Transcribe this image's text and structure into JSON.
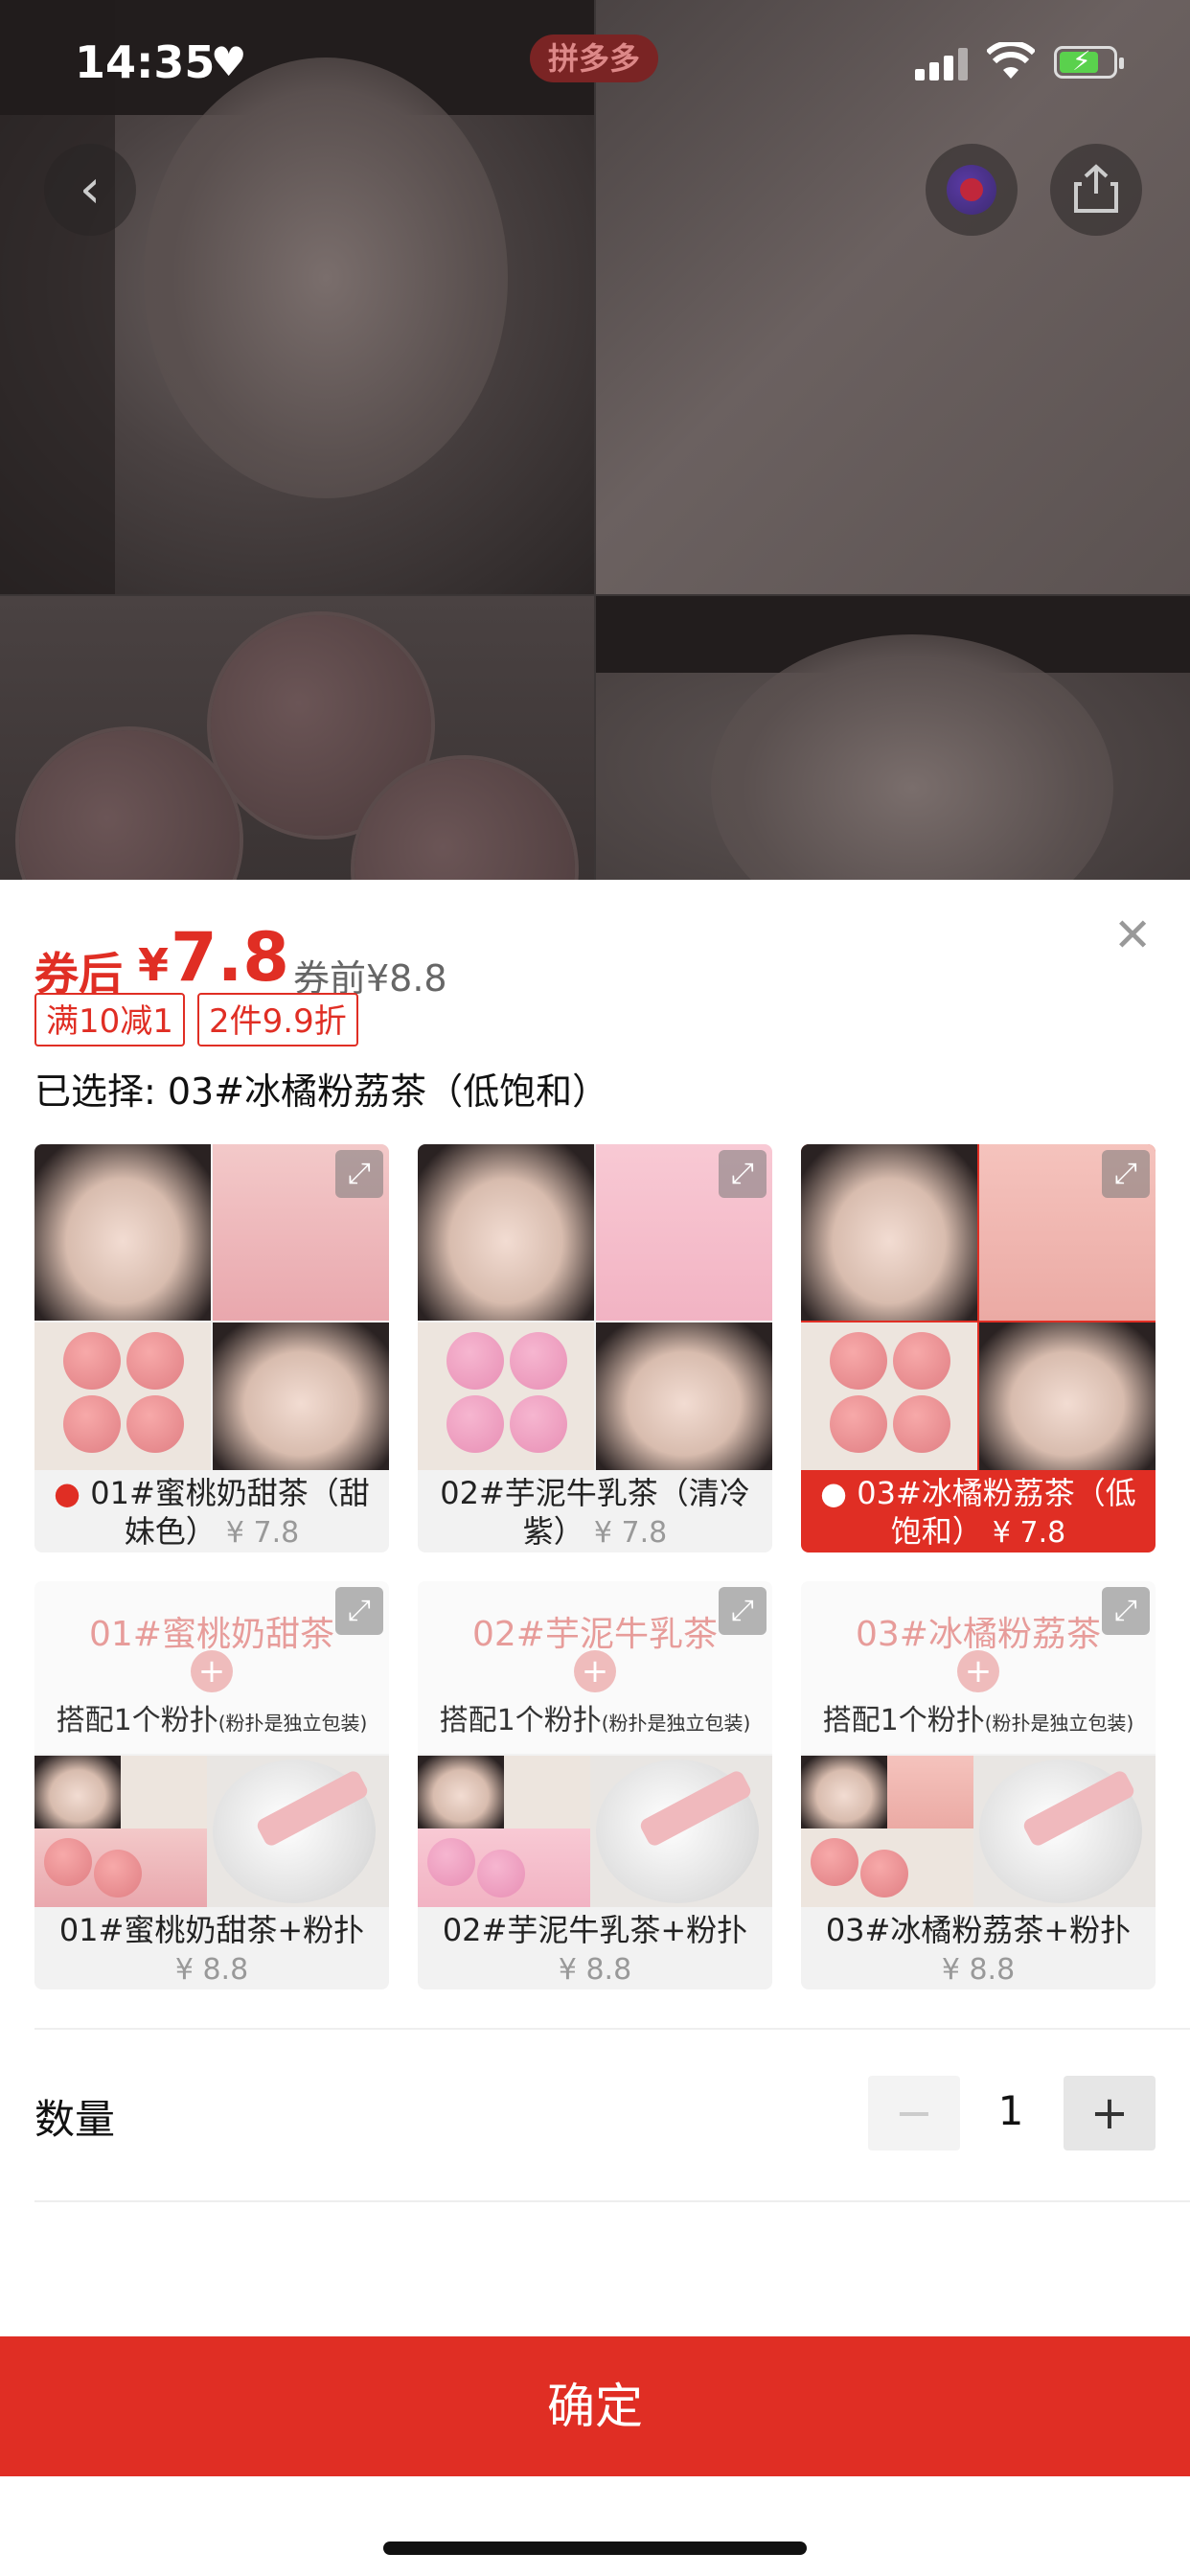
{
  "status_bar": {
    "time": "14:35",
    "app_badge": "拼多多"
  },
  "price": {
    "after_label": "券后",
    "currency": "¥",
    "after_value": "7.8",
    "before_text": "券前¥8.8"
  },
  "tags": [
    "满10减1",
    "2件9.9折"
  ],
  "selected_text": "已选择: 03#冰橘粉荔茶（低饱和）",
  "variants": [
    {
      "name_line1": "01#蜜桃奶甜茶（甜",
      "name_line2": "妹色）",
      "price": "¥ 7.8",
      "hot": true,
      "selected": false
    },
    {
      "name_line1": "02#芋泥牛乳茶（清冷",
      "name_line2": "紫）",
      "price": "¥ 7.8",
      "hot": false,
      "selected": false
    },
    {
      "name_line1": "03#冰橘粉荔茶（低",
      "name_line2": "饱和）",
      "price": "¥ 7.8",
      "hot": true,
      "selected": true
    }
  ],
  "combos": [
    {
      "image_title": "01#蜜桃奶甜茶",
      "image_sub": "搭配1个粉扑",
      "image_note": "(粉扑是独立包装)",
      "name": "01#蜜桃奶甜茶+粉扑",
      "price": "¥ 8.8"
    },
    {
      "image_title": "02#芋泥牛乳茶",
      "image_sub": "搭配1个粉扑",
      "image_note": "(粉扑是独立包装)",
      "name": "02#芋泥牛乳茶+粉扑",
      "price": "¥ 8.8"
    },
    {
      "image_title": "03#冰橘粉荔茶",
      "image_sub": "搭配1个粉扑",
      "image_note": "(粉扑是独立包装)",
      "name": "03#冰橘粉荔茶+粉扑",
      "price": "¥ 8.8"
    }
  ],
  "quantity": {
    "label": "数量",
    "value": "1",
    "minus": "−",
    "plus": "+"
  },
  "confirm_label": "确定",
  "icons": {
    "back": "chevron-left-icon",
    "favorite": "favorite-icon",
    "share": "share-icon",
    "close": "close-icon",
    "expand": "expand-icon",
    "hot": "fire-icon"
  },
  "colors": {
    "accent": "#e02e24",
    "muted": "#999999"
  }
}
